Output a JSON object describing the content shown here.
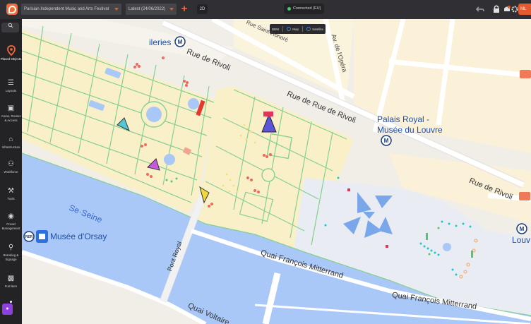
{
  "topbar": {
    "project": "Parisian Independent Music and Arts Festival",
    "version": "Latest (24/06/2022)",
    "view_3d": "2D",
    "status": "Connected (EU)",
    "avatar_initials": "ML"
  },
  "sidebar": {
    "items": [
      {
        "label": "Placed Objects",
        "icon": "placed-objects-icon"
      },
      {
        "label": "Layouts",
        "icon": "layouts-icon"
      },
      {
        "label": "Areas, Routes & Access",
        "icon": "areas-routes-icon"
      },
      {
        "label": "Infrastructure",
        "icon": "infrastructure-icon"
      },
      {
        "label": "Workforce",
        "icon": "workforce-icon"
      },
      {
        "label": "Tools",
        "icon": "tools-icon"
      },
      {
        "label": "Crowd Management",
        "icon": "crowd-management-icon"
      },
      {
        "label": "Branding & Signage",
        "icon": "branding-signage-icon"
      },
      {
        "label": "Furniture",
        "icon": "furniture-icon"
      }
    ]
  },
  "map_type": {
    "options": [
      "BBW",
      "Map",
      "Satellite"
    ]
  },
  "map_labels": {
    "tuileries": "ileries",
    "rue_rivoli_1": "Rue de Rivoli",
    "rue_rivoli_2": "Rue de Rue de Rivoli",
    "rue_rivoli_3": "Rue de Rivoli",
    "saint_honore": "Rue Saint-Honoré",
    "av_opera": "Av. de l'Opéra",
    "palais_royal_1": "Palais Royal -",
    "palais_royal_2": "Musée du Louvre",
    "seine": "Se·Seine",
    "musee_orsay": "Musée d'Orsay",
    "rer": "RER",
    "pont_royal": "Pont Royal",
    "quai_1": "Quai François Mitterrand",
    "quai_2": "Quai François Mitterrand",
    "quai_3": "Quai Voltaire",
    "louvre_edge": "Louv",
    "metro": "M"
  },
  "colors": {
    "accent": "#f06a3a",
    "water": "#a9c8f7",
    "park": "#faf0c8",
    "path": "#7dc98c"
  }
}
